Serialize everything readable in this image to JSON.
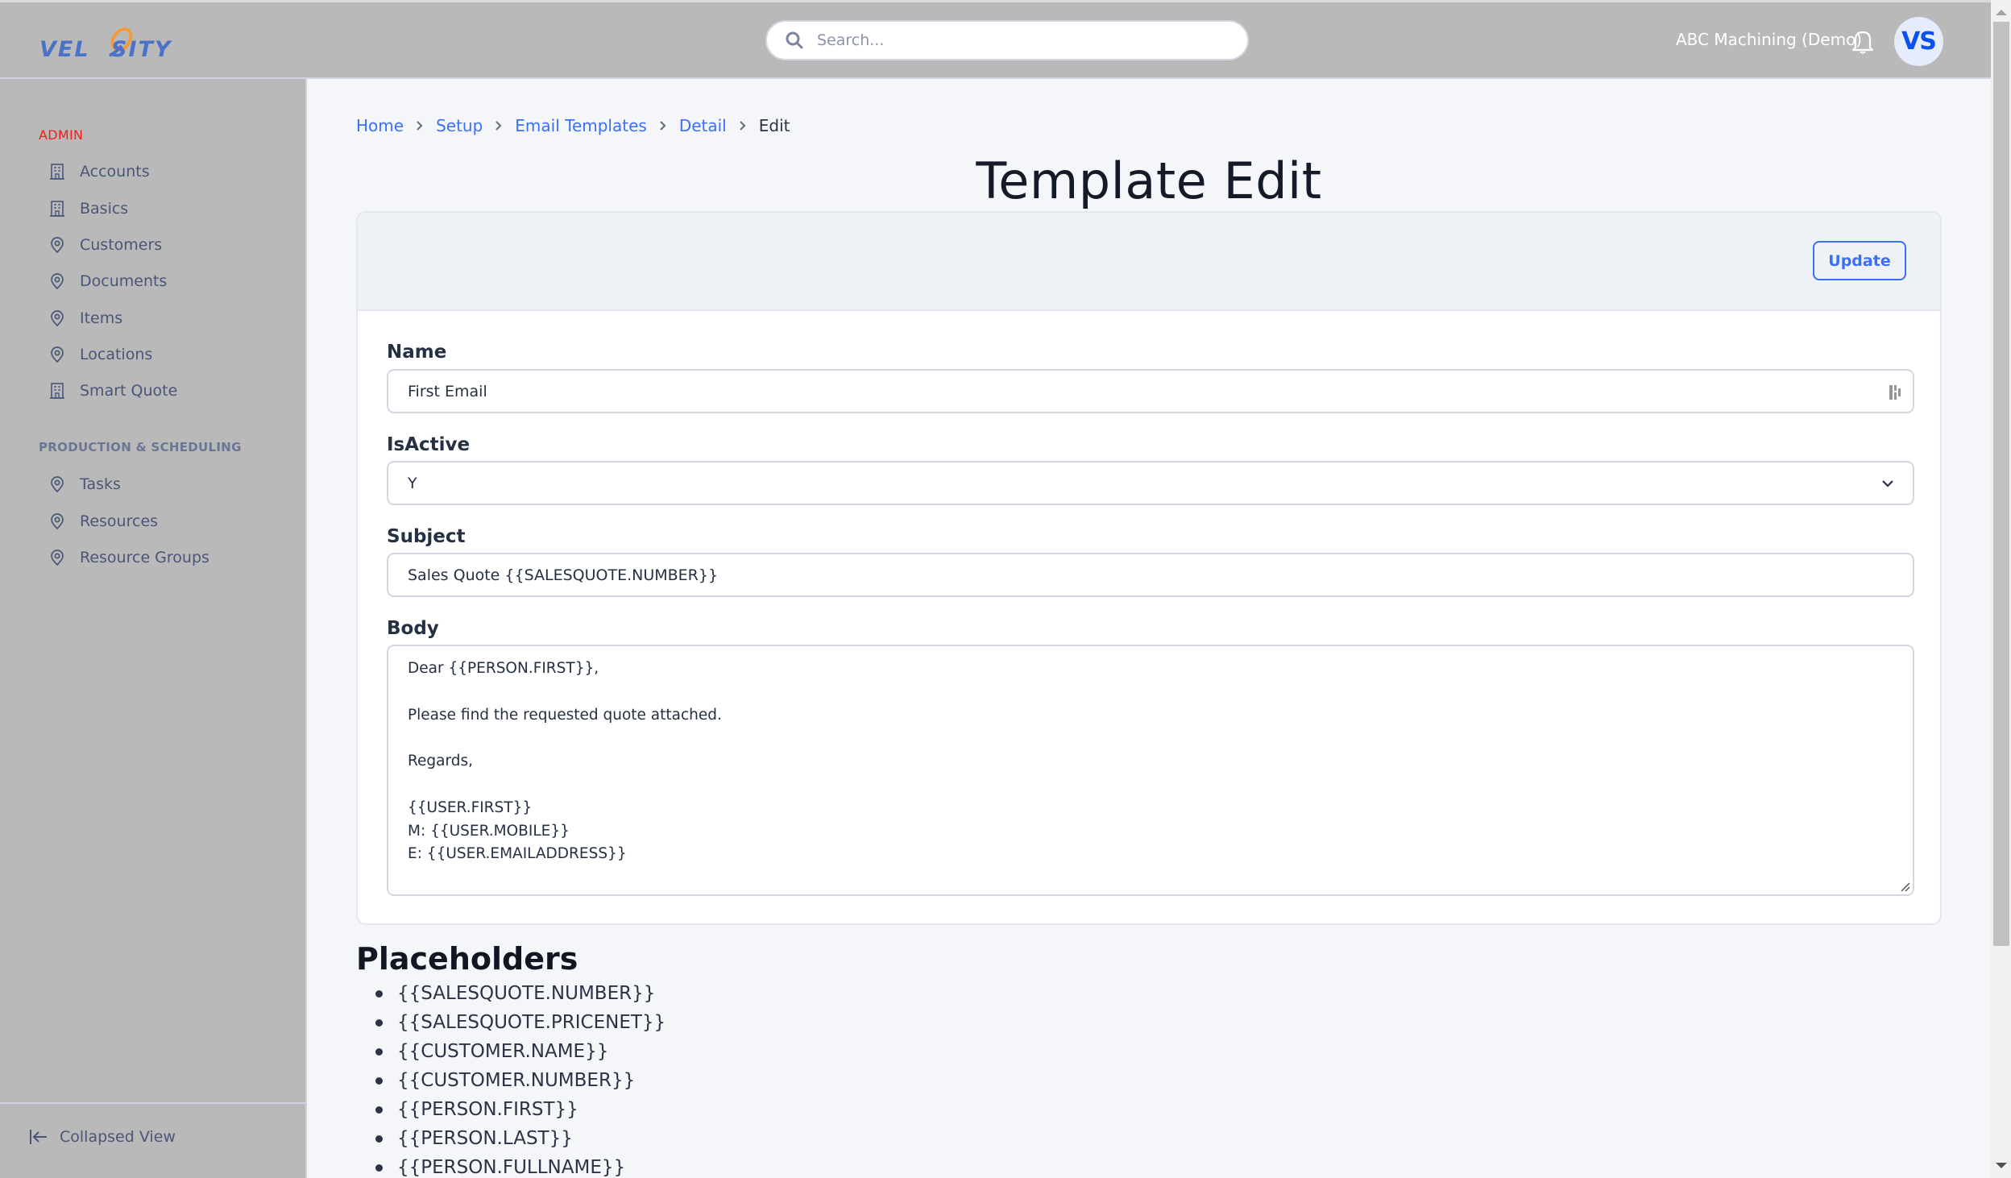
{
  "app": {
    "brand": "VELOSITY",
    "colors": {
      "header_bg": "#b9b9b9",
      "accent": "#3b6ff5",
      "logo_blue": "#4a72c8",
      "logo_orange": "#f59a3c",
      "admin_label": "#ff1a1a",
      "avatar_text": "#0d50f2",
      "avatar_bg": "#e6ecfc"
    }
  },
  "header": {
    "search": {
      "placeholder": "Search...",
      "value": "",
      "icon": "search-icon"
    },
    "tenant": "ABC Machining (Demo)",
    "notifications_icon": "bell-icon",
    "avatar_initials": "VS"
  },
  "sidebar": {
    "sections": [
      {
        "title": "ADMIN",
        "items": [
          {
            "label": "Accounts",
            "icon": "building-icon"
          },
          {
            "label": "Basics",
            "icon": "building-icon"
          },
          {
            "label": "Customers",
            "icon": "map-pin-icon"
          },
          {
            "label": "Documents",
            "icon": "map-pin-icon"
          },
          {
            "label": "Items",
            "icon": "map-pin-icon"
          },
          {
            "label": "Locations",
            "icon": "map-pin-icon"
          },
          {
            "label": "Smart Quote",
            "icon": "building-icon"
          }
        ]
      },
      {
        "title": "PRODUCTION & SCHEDULING",
        "items": [
          {
            "label": "Tasks",
            "icon": "map-pin-icon"
          },
          {
            "label": "Resources",
            "icon": "map-pin-icon"
          },
          {
            "label": "Resource Groups",
            "icon": "map-pin-icon"
          }
        ]
      }
    ],
    "footer": {
      "label": "Collapsed View",
      "icon": "collapse-left-icon"
    }
  },
  "breadcrumb": {
    "items": [
      "Home",
      "Setup",
      "Email Templates",
      "Detail"
    ],
    "current": "Edit"
  },
  "page": {
    "title": "Template Edit",
    "update_label": "Update"
  },
  "form": {
    "name": {
      "label": "Name",
      "value": "First Email"
    },
    "is_active": {
      "label": "IsActive",
      "value": "Y",
      "options": [
        "Y"
      ]
    },
    "subject": {
      "label": "Subject",
      "value": "Sales Quote {{SALESQUOTE.NUMBER}}"
    },
    "body": {
      "label": "Body",
      "value": "Dear {{PERSON.FIRST}},\n\nPlease find the requested quote attached.\n\nRegards,\n\n{{USER.FIRST}}\nM: {{USER.MOBILE}}\nE: {{USER.EMAILADDRESS}}"
    }
  },
  "placeholders": {
    "title": "Placeholders",
    "items": [
      "{{SALESQUOTE.NUMBER}}",
      "{{SALESQUOTE.PRICENET}}",
      "{{CUSTOMER.NAME}}",
      "{{CUSTOMER.NUMBER}}",
      "{{PERSON.FIRST}}",
      "{{PERSON.LAST}}",
      "{{PERSON.FULLNAME}}"
    ]
  }
}
